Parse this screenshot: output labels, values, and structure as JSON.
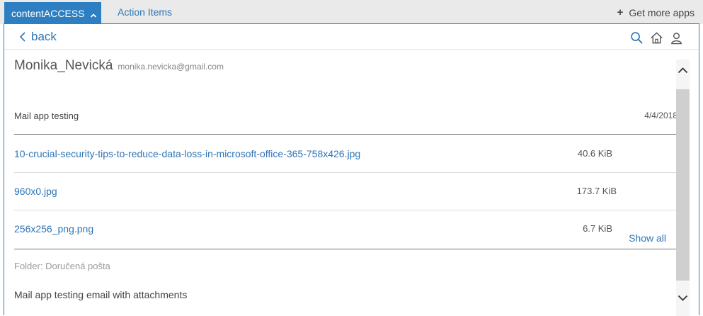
{
  "topbar": {
    "active_tab": "contentACCESS",
    "tab2": "Action Items",
    "get_more": "Get more apps"
  },
  "nav": {
    "back_label": "back"
  },
  "message": {
    "sender_name": "Monika_Nevická",
    "sender_email": "monika.nevicka@gmail.com",
    "subject": "Mail app testing",
    "date": "4/4/2018",
    "attachments": [
      {
        "name": "10-crucial-security-tips-to-reduce-data-loss-in-microsoft-office-365-758x426.jpg",
        "size": "40.6 KiB"
      },
      {
        "name": "960x0.jpg",
        "size": "173.7 KiB"
      },
      {
        "name": "256x256_png.png",
        "size": "6.7 KiB"
      }
    ],
    "show_all": "Show all",
    "folder": "Folder: Doručená pošta",
    "preview": "Mail app testing email with attachments"
  },
  "colors": {
    "accent": "#2e7fc1",
    "link": "#2e74b5",
    "topbar_bg": "#eaeaea"
  },
  "icons": [
    "chevron-up-icon",
    "plus-icon",
    "chevron-left-icon",
    "search-icon",
    "home-icon",
    "user-icon",
    "scroll-up-icon",
    "scroll-down-icon"
  ]
}
